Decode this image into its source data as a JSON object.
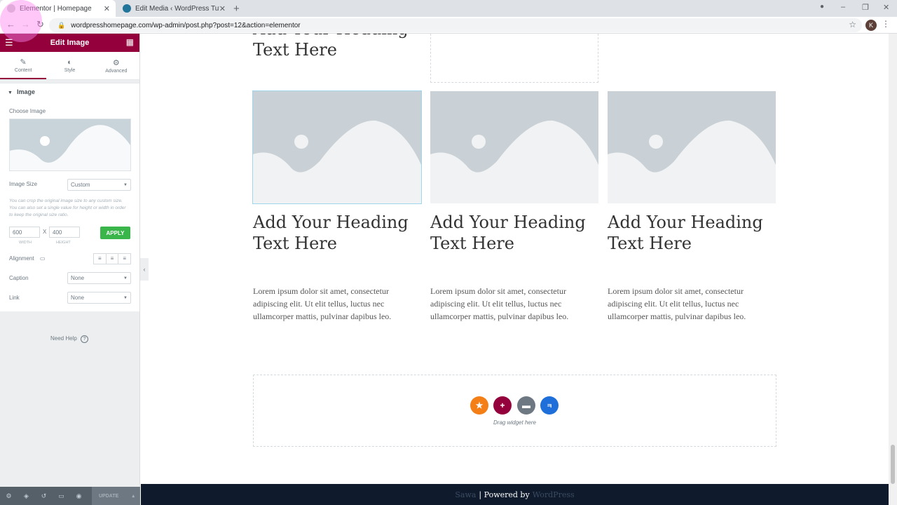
{
  "browser": {
    "tabs": [
      {
        "title": "Elementor | Homepage",
        "active": true
      },
      {
        "title": "Edit Media ‹ WordPress Tutorial",
        "active": false
      }
    ],
    "url": "wordpresshomepage.com/wp-admin/post.php?post=12&action=elementor",
    "profile_initial": "K"
  },
  "panel": {
    "title": "Edit Image",
    "tabs": [
      {
        "label": "Content",
        "icon": "pencil-icon",
        "active": true
      },
      {
        "label": "Style",
        "icon": "contrast-icon",
        "active": false
      },
      {
        "label": "Advanced",
        "icon": "gear-icon",
        "active": false
      }
    ],
    "section_title": "Image",
    "choose_image_label": "Choose Image",
    "image_size": {
      "label": "Image Size",
      "value": "Custom"
    },
    "crop_note": "You can crop the original image size to any custom size. You can also set a single value for height or width in order to keep the original size ratio.",
    "width": {
      "value": "600",
      "caption": "WIDTH"
    },
    "height": {
      "value": "400",
      "caption": "HEIGHT"
    },
    "times": "X",
    "apply_label": "APPLY",
    "alignment_label": "Alignment",
    "caption": {
      "label": "Caption",
      "value": "None"
    },
    "link": {
      "label": "Link",
      "value": "None"
    },
    "need_help": "Need Help",
    "update_label": "UPDATE"
  },
  "canvas": {
    "top_heading": "Add Your Heading Text Here",
    "columns": [
      {
        "heading": "Add Your Heading Text Here",
        "text": "Lorem ipsum dolor sit amet, consectetur adipiscing elit. Ut elit tellus, luctus nec ullamcorper mattis, pulvinar dapibus leo."
      },
      {
        "heading": "Add Your Heading Text Here",
        "text": "Lorem ipsum dolor sit amet, consectetur adipiscing elit. Ut elit tellus, luctus nec ullamcorper mattis, pulvinar dapibus leo."
      },
      {
        "heading": "Add Your Heading Text Here",
        "text": "Lorem ipsum dolor sit amet, consectetur adipiscing elit. Ut elit tellus, luctus nec ullamcorper mattis, pulvinar dapibus leo."
      }
    ],
    "drag_text": "Drag widget here",
    "footer": {
      "left": "Sawa",
      "powered": "| Powered by",
      "right": "WordPress"
    }
  },
  "colors": {
    "brand": "#93003c",
    "apply": "#39b54a",
    "footer": "#0f1b2d",
    "orange": "#f57f17",
    "grey": "#6d7882",
    "blue": "#1e6fd9"
  }
}
